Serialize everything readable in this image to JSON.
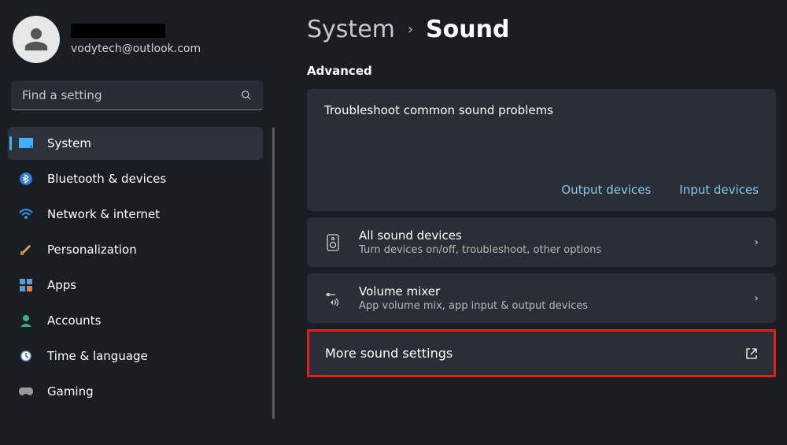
{
  "profile": {
    "email": "vodytech@outlook.com"
  },
  "search": {
    "placeholder": "Find a setting"
  },
  "sidebar": {
    "items": [
      {
        "label": "System",
        "icon": "system"
      },
      {
        "label": "Bluetooth & devices",
        "icon": "bluetooth"
      },
      {
        "label": "Network & internet",
        "icon": "network"
      },
      {
        "label": "Personalization",
        "icon": "personalization"
      },
      {
        "label": "Apps",
        "icon": "apps"
      },
      {
        "label": "Accounts",
        "icon": "accounts"
      },
      {
        "label": "Time & language",
        "icon": "time"
      },
      {
        "label": "Gaming",
        "icon": "gaming"
      }
    ]
  },
  "breadcrumb": {
    "parent": "System",
    "current": "Sound"
  },
  "sections": {
    "advanced": "Advanced",
    "troubleshoot": {
      "title": "Troubleshoot common sound problems",
      "links": {
        "output": "Output devices",
        "input": "Input devices"
      }
    },
    "allDevices": {
      "title": "All sound devices",
      "sub": "Turn devices on/off, troubleshoot, other options"
    },
    "mixer": {
      "title": "Volume mixer",
      "sub": "App volume mix, app input & output devices"
    },
    "more": {
      "title": "More sound settings"
    }
  }
}
